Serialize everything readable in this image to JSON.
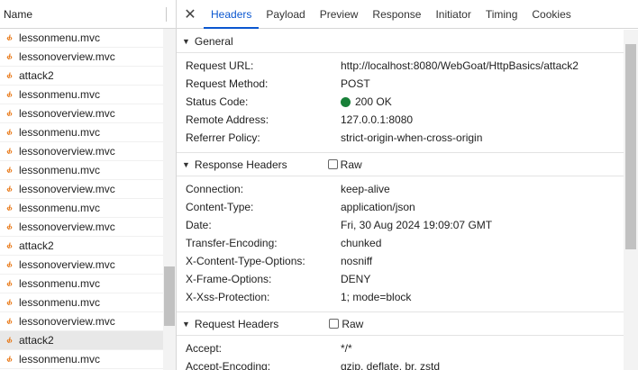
{
  "list": {
    "header": "Name",
    "rows": [
      {
        "name": "lessonmenu.mvc",
        "selected": false
      },
      {
        "name": "lessonoverview.mvc",
        "selected": false
      },
      {
        "name": "attack2",
        "selected": false
      },
      {
        "name": "lessonmenu.mvc",
        "selected": false
      },
      {
        "name": "lessonoverview.mvc",
        "selected": false
      },
      {
        "name": "lessonmenu.mvc",
        "selected": false
      },
      {
        "name": "lessonoverview.mvc",
        "selected": false
      },
      {
        "name": "lessonmenu.mvc",
        "selected": false
      },
      {
        "name": "lessonoverview.mvc",
        "selected": false
      },
      {
        "name": "lessonmenu.mvc",
        "selected": false
      },
      {
        "name": "lessonoverview.mvc",
        "selected": false
      },
      {
        "name": "attack2",
        "selected": false
      },
      {
        "name": "lessonoverview.mvc",
        "selected": false
      },
      {
        "name": "lessonmenu.mvc",
        "selected": false
      },
      {
        "name": "lessonmenu.mvc",
        "selected": false
      },
      {
        "name": "lessonoverview.mvc",
        "selected": false
      },
      {
        "name": "attack2",
        "selected": true
      },
      {
        "name": "lessonmenu.mvc",
        "selected": false
      }
    ],
    "file_icon_glyph": "‹/›"
  },
  "tabs": {
    "close_glyph": "✕",
    "items": [
      "Headers",
      "Payload",
      "Preview",
      "Response",
      "Initiator",
      "Timing",
      "Cookies"
    ],
    "active": "Headers"
  },
  "general": {
    "title": "General",
    "rows": [
      {
        "key": "Request URL:",
        "value": "http://localhost:8080/WebGoat/HttpBasics/attack2"
      },
      {
        "key": "Request Method:",
        "value": "POST"
      },
      {
        "key": "Status Code:",
        "value": "200 OK"
      },
      {
        "key": "Remote Address:",
        "value": "127.0.0.1:8080"
      },
      {
        "key": "Referrer Policy:",
        "value": "strict-origin-when-cross-origin"
      }
    ]
  },
  "response_headers": {
    "title": "Response Headers",
    "raw_label": "Raw",
    "rows": [
      {
        "key": "Connection:",
        "value": "keep-alive"
      },
      {
        "key": "Content-Type:",
        "value": "application/json"
      },
      {
        "key": "Date:",
        "value": "Fri, 30 Aug 2024 19:09:07 GMT"
      },
      {
        "key": "Transfer-Encoding:",
        "value": "chunked"
      },
      {
        "key": "X-Content-Type-Options:",
        "value": "nosniff"
      },
      {
        "key": "X-Frame-Options:",
        "value": "DENY"
      },
      {
        "key": "X-Xss-Protection:",
        "value": "1; mode=block"
      }
    ]
  },
  "request_headers": {
    "title": "Request Headers",
    "raw_label": "Raw",
    "rows": [
      {
        "key": "Accept:",
        "value": "*/*"
      },
      {
        "key": "Accept-Encoding:",
        "value": "gzip, deflate, br, zstd"
      }
    ]
  },
  "colors": {
    "accent": "#0b57d0",
    "status_ok": "#188038",
    "file_icon": "#e8710a"
  }
}
